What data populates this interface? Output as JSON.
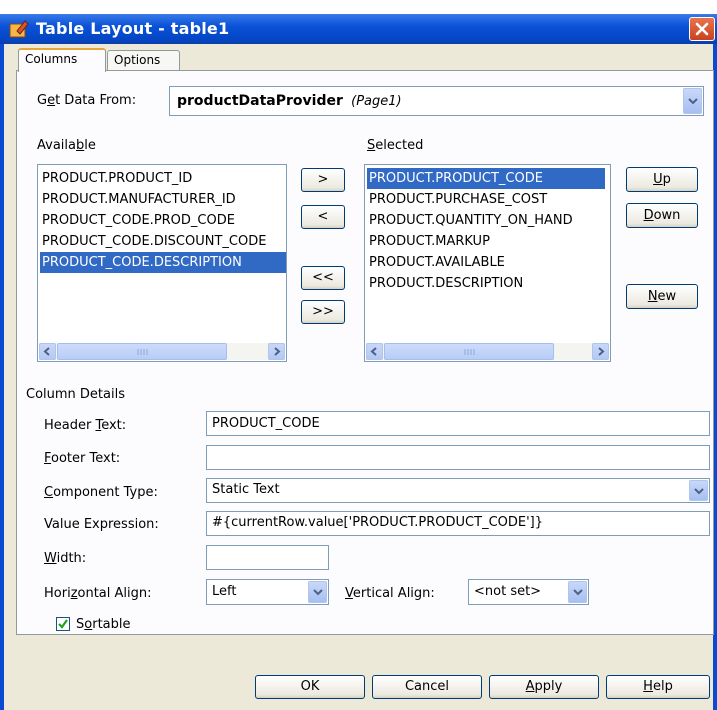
{
  "window": {
    "title": "Table Layout - table1"
  },
  "tabs": [
    "Columns",
    "Options"
  ],
  "get_data": {
    "label_pre": "G",
    "label_ul": "e",
    "label_post": "t Data From:",
    "provider": "productDataProvider",
    "page": "(Page1)"
  },
  "available": {
    "label_pre": "Availa",
    "label_ul": "b",
    "label_post": "le",
    "items": [
      "PRODUCT.PRODUCT_ID",
      "PRODUCT.MANUFACTURER_ID",
      "PRODUCT_CODE.PROD_CODE",
      "PRODUCT_CODE.DISCOUNT_CODE",
      "PRODUCT_CODE.DESCRIPTION"
    ],
    "selected_index": 4
  },
  "move_buttons": {
    "add": ">",
    "remove": "<",
    "remove_all": "<<",
    "add_all": ">>"
  },
  "selected": {
    "label_ul": "S",
    "label_post": "elected",
    "items": [
      "PRODUCT.PRODUCT_CODE",
      "PRODUCT.PURCHASE_COST",
      "PRODUCT.QUANTITY_ON_HAND",
      "PRODUCT.MARKUP",
      "PRODUCT.AVAILABLE",
      "PRODUCT.DESCRIPTION"
    ],
    "selected_index": 0
  },
  "order_buttons": {
    "up_ul": "U",
    "up_post": "p",
    "down_ul": "D",
    "down_post": "own",
    "new_ul": "N",
    "new_post": "ew"
  },
  "details": {
    "section_label": "Column Details",
    "header_text": {
      "pre": "Header ",
      "ul": "T",
      "post": "ext:",
      "value": "PRODUCT_CODE"
    },
    "footer_text": {
      "ul": "F",
      "post": "ooter Text:",
      "value": ""
    },
    "component_type": {
      "ul": "C",
      "post": "omponent Type:",
      "value": "Static Text"
    },
    "value_expression": {
      "label": "Value Expression:",
      "value": "#{currentRow.value['PRODUCT.PRODUCT_CODE']}"
    },
    "width": {
      "ul": "W",
      "post": "idth:",
      "value": ""
    },
    "horizontal_align": {
      "pre": "Hori",
      "ul": "z",
      "post": "ontal Align:",
      "value": "Left"
    },
    "vertical_align": {
      "ul": "V",
      "post": "ertical Align:",
      "value": "<not set>"
    },
    "sortable": {
      "pre": "S",
      "ul": "o",
      "post": "rtable",
      "checked": true
    }
  },
  "footer_buttons": {
    "ok": "OK",
    "cancel": "Cancel",
    "apply_ul": "A",
    "apply_post": "pply",
    "help_ul": "H",
    "help_post": "elp"
  }
}
